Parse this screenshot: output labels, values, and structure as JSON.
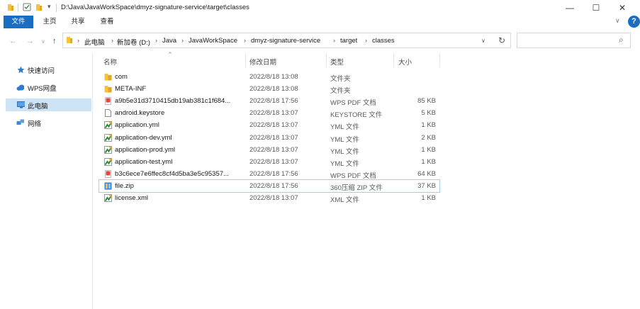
{
  "window": {
    "title_path": "D:\\Java\\JavaWorkSpace\\dmyz-signature-service\\target\\classes",
    "minimize_glyph": "—",
    "maximize_glyph": "☐",
    "close_glyph": "✕",
    "help_glyph": "?"
  },
  "ribbon": {
    "tabs": [
      "文件",
      "主页",
      "共享",
      "查看"
    ],
    "expand_glyph": "∨"
  },
  "address": {
    "back_glyph": "←",
    "forward_glyph": "→",
    "recent_glyph": "∨",
    "up_glyph": "↑",
    "crumbs": [
      "此电脑",
      "新加卷 (D:)",
      "Java",
      "JavaWorkSpace",
      "dmyz-signature-service",
      "target",
      "classes"
    ],
    "separator_glyph": "›",
    "dropdown_glyph": "∨",
    "refresh_glyph": "↻",
    "search_glyph": "⌕",
    "search_placeholder": ""
  },
  "sidebar": {
    "items": [
      {
        "label": "快速访问",
        "icon": "pin-icon",
        "color": "#2b7cd3"
      },
      {
        "label": "WPS网盘",
        "icon": "cloud-icon",
        "color": "#2b7cd3"
      },
      {
        "label": "此电脑",
        "icon": "computer-icon",
        "color": "#3b8ad8"
      },
      {
        "label": "网络",
        "icon": "network-icon",
        "color": "#3b8ad8"
      }
    ]
  },
  "columns": {
    "name": "名称",
    "date": "修改日期",
    "type": "类型",
    "size": "大小",
    "sort_glyph": "^"
  },
  "files": [
    {
      "name": "com",
      "date": "2022/8/18 13:08",
      "type": "文件夹",
      "size": "",
      "icon": "folder-icon"
    },
    {
      "name": "META-INF",
      "date": "2022/8/18 13:08",
      "type": "文件夹",
      "size": "",
      "icon": "folder-icon"
    },
    {
      "name": "a9b5e31d3710415db19ab381c1f684...",
      "date": "2022/8/18 17:56",
      "type": "WPS PDF 文档",
      "size": "85 KB",
      "icon": "pdf-icon"
    },
    {
      "name": "android.keystore",
      "date": "2022/8/18 13:07",
      "type": "KEYSTORE 文件",
      "size": "5 KB",
      "icon": "file-icon"
    },
    {
      "name": "application.yml",
      "date": "2022/8/18 13:07",
      "type": "YML 文件",
      "size": "1 KB",
      "icon": "yml-icon"
    },
    {
      "name": "application-dev.yml",
      "date": "2022/8/18 13:07",
      "type": "YML 文件",
      "size": "2 KB",
      "icon": "yml-icon"
    },
    {
      "name": "application-prod.yml",
      "date": "2022/8/18 13:07",
      "type": "YML 文件",
      "size": "1 KB",
      "icon": "yml-icon"
    },
    {
      "name": "application-test.yml",
      "date": "2022/8/18 13:07",
      "type": "YML 文件",
      "size": "1 KB",
      "icon": "yml-icon"
    },
    {
      "name": "b3c6ece7e6ffec8cf4d5ba3e5c95357...",
      "date": "2022/8/18 17:56",
      "type": "WPS PDF 文档",
      "size": "64 KB",
      "icon": "pdf-icon"
    },
    {
      "name": "file.zip",
      "date": "2022/8/18 17:56",
      "type": "360压缩 ZIP 文件",
      "size": "37 KB",
      "icon": "zip-icon"
    },
    {
      "name": "license.xml",
      "date": "2022/8/18 13:07",
      "type": "XML 文件",
      "size": "1 KB",
      "icon": "xml-icon"
    }
  ],
  "colors": {
    "accent": "#1a6ec2",
    "selection": "#cde4f7",
    "folder": "#f5c242",
    "pdf": "#e0443a"
  }
}
